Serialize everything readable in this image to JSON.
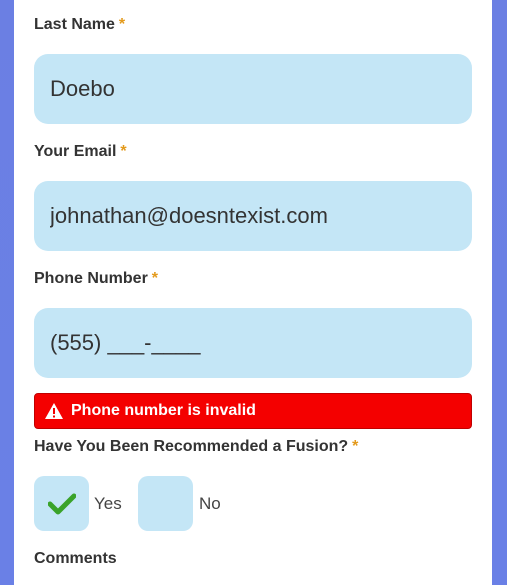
{
  "form": {
    "last_name": {
      "label": "Last Name",
      "required_mark": "*",
      "value": "Doebo"
    },
    "email": {
      "label": "Your Email",
      "required_mark": "*",
      "value": "johnathan@doesntexist.com"
    },
    "phone": {
      "label": "Phone Number",
      "required_mark": "*",
      "value": "(555) ___-____"
    },
    "phone_error": "Phone number is invalid",
    "recommended": {
      "label": "Have You Been Recommended a Fusion?",
      "required_mark": "*",
      "options": [
        {
          "label": "Yes",
          "checked": true
        },
        {
          "label": "No",
          "checked": false
        }
      ]
    },
    "comments": {
      "label": "Comments"
    }
  },
  "colors": {
    "background": "#6b7fe3",
    "field_bg": "#c4e6f6",
    "required": "#e39a1c",
    "error": "#f40000",
    "check": "#3aa32a"
  }
}
